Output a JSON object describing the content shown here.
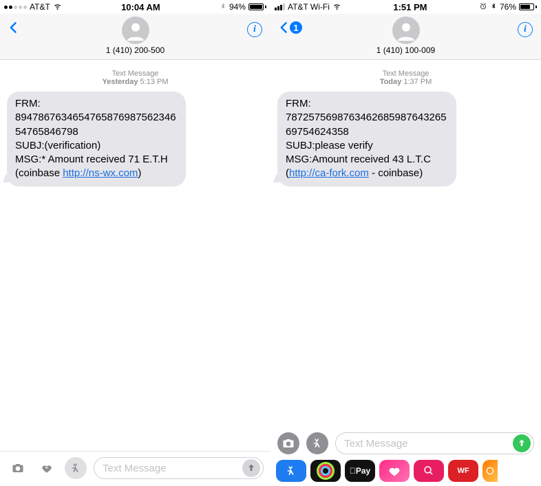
{
  "left": {
    "status": {
      "carrier": "AT&T",
      "time": "10:04 AM",
      "battery_pct": "94%"
    },
    "contact": "1 (410) 200-500",
    "ts_source": "Text Message",
    "ts_label": "Yesterday",
    "ts_time": "5:13 PM",
    "msg": {
      "line1": "FRM:",
      "line2": "894786763465476587698756234654765846798",
      "line3": "SUBJ:(verification)",
      "line4a": "MSG:* Amount received 71 E.T.H (coinbase ",
      "link": "http://ns-wx.com",
      "line4b": ")"
    },
    "input_placeholder": "Text Message"
  },
  "right": {
    "status": {
      "carrier": "AT&T Wi-Fi",
      "time": "1:51 PM",
      "battery_pct": "76%"
    },
    "back_badge": "1",
    "contact": "1 (410) 100-009",
    "ts_source": "Text Message",
    "ts_label": "Today",
    "ts_time": "1:37 PM",
    "msg": {
      "line1": "FRM:",
      "line2": "787257569876346268598764326569754624358",
      "line3": "SUBJ:please verify",
      "line4a": "MSG:Amount received 43 L.T.C (",
      "link": "http://ca-fork.com",
      "line4b": " - coinbase)"
    },
    "input_placeholder": "Text Message",
    "drawer": {
      "applepay": "Pay",
      "wf": "WF"
    }
  }
}
